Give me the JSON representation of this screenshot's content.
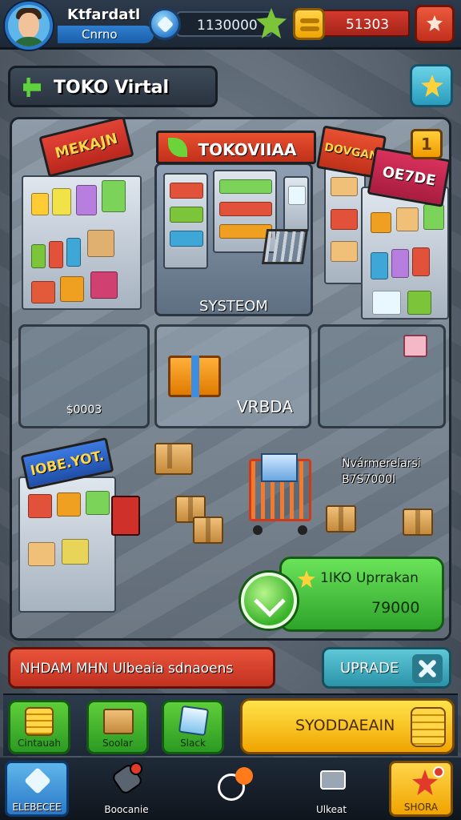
{
  "player": {
    "name": "Ktfardatl",
    "subtitle": "Cnrno",
    "resource_1": "1130000",
    "resource_2": "51303"
  },
  "header": {
    "title": "TOKO Virtal"
  },
  "store": {
    "left_sign": "MEKAJN",
    "center_sign": "TOKOVIIAA",
    "right_sign_1": "DOVGAN",
    "right_sign_2": "OE7DE",
    "level_badge": "1",
    "system_label": "SYSTEOM",
    "slot_left_label": "$0003",
    "slot_center_label": "VRBDA",
    "bottom_left_sign": "IOBE.YOT.",
    "info_line_1": "Nvármerelarsi",
    "info_line_2": "B7S7000I"
  },
  "upgrade_card": {
    "title": "1IKO Uprrakan",
    "price": "79000"
  },
  "message_bar": {
    "text": "NHDAM MHN Ulbeaia sdnaoens"
  },
  "upgrade_button": {
    "label": "UPRADE"
  },
  "items": [
    {
      "label": "Cintauah",
      "icon": "coin-stack-icon"
    },
    {
      "label": "Soolar",
      "icon": "box-icon"
    },
    {
      "label": "Slack",
      "icon": "cube-icon"
    }
  ],
  "collect_button": {
    "label": "SYODDAEAIN"
  },
  "nav": [
    {
      "label": "ELEBECEE",
      "icon": "cube-icon"
    },
    {
      "label": "Boocanie",
      "icon": "tool-icon"
    },
    {
      "label": "",
      "icon": "ring-icon"
    },
    {
      "label": "Ulkeat",
      "icon": "chart-icon"
    },
    {
      "label": "SHORA",
      "icon": "star-icon"
    }
  ],
  "colors": {
    "accent_green": "#2ea32a",
    "accent_red": "#c23220",
    "accent_gold": "#f0a400",
    "accent_blue": "#2a78c8"
  }
}
